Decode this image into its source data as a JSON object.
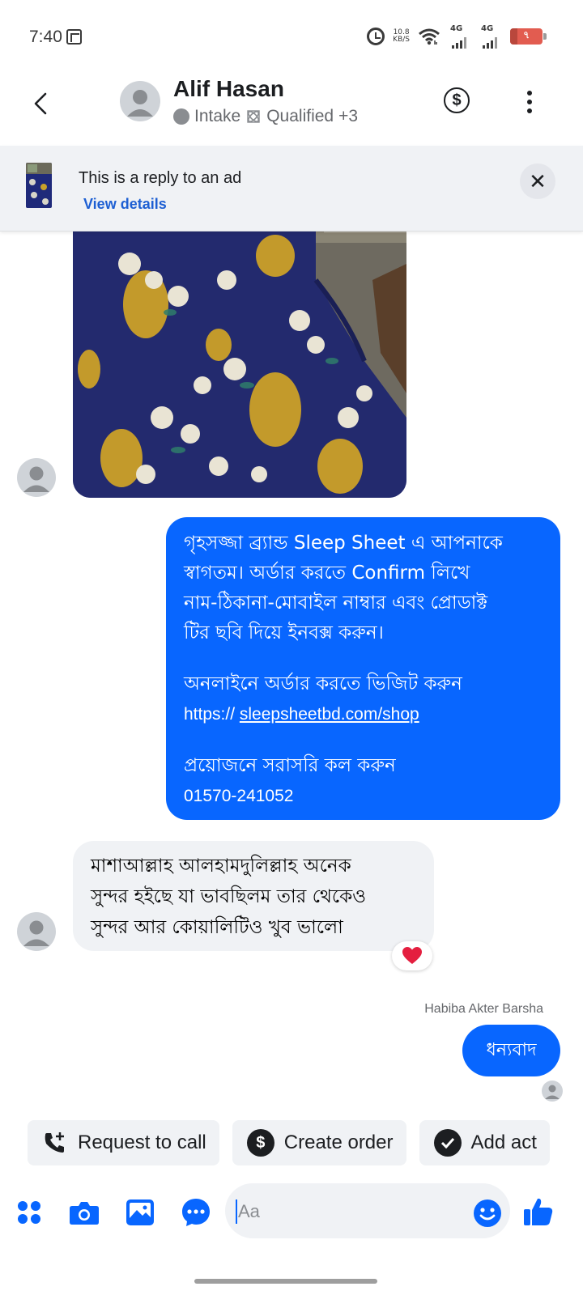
{
  "status_bar": {
    "time": "7:40",
    "net_speed_value": "10.8",
    "net_speed_unit": "KB/S",
    "sim1_label": "4G",
    "sim2_label": "4G",
    "battery_level": "৭"
  },
  "header": {
    "contact_name": "Alif Hasan",
    "stage_intake": "Intake",
    "stage_qualified": "Qualified",
    "stage_more": "+3"
  },
  "ad_banner": {
    "title": "This is a reply to an ad",
    "link_label": "View details"
  },
  "messages": {
    "outgoing_welcome": {
      "line1": "গৃহসজ্জা ব্র্যান্ড Sleep Sheet এ আপনাকে",
      "line2": "স্বাগতম। অর্ডার করতে Confirm লিখে",
      "line3": "নাম-ঠিকানা-মোবাইল নাম্বার এবং প্রোডাক্ট",
      "line4": "টির ছবি দিয়ে ইনবক্স করুন।",
      "line5": "অনলাইনে অর্ডার করতে ভিজিট করুন",
      "url_prefix": "https://",
      "url_link": "sleepsheetbd.com/shop",
      "line6": "প্রয়োজনে সরাসরি কল করুন",
      "phone": "01570-241052"
    },
    "incoming_review": {
      "line1": "মাশাআল্লাহ আলহামদুলিল্লাহ অনেক",
      "line2": "সুন্দর হইছে যা ভাবছিলম তার থেকেও",
      "line3": "সুন্দর আর কোয়ালিটিও খুব ভালো",
      "reaction": "heart"
    },
    "sender_label": "Habiba Akter Barsha",
    "outgoing_thanks": "ধন্যবাদ"
  },
  "quick_actions": [
    {
      "label": "Request to call",
      "icon": "phone-plus-icon"
    },
    {
      "label": "Create order",
      "icon": "dollar-circle-icon"
    },
    {
      "label": "Add act",
      "icon": "check-circle-icon"
    }
  ],
  "composer": {
    "placeholder": "Aa"
  },
  "colors": {
    "accent": "#0866ff",
    "bubble_incoming": "#f0f2f5",
    "text_secondary": "#65676b"
  }
}
